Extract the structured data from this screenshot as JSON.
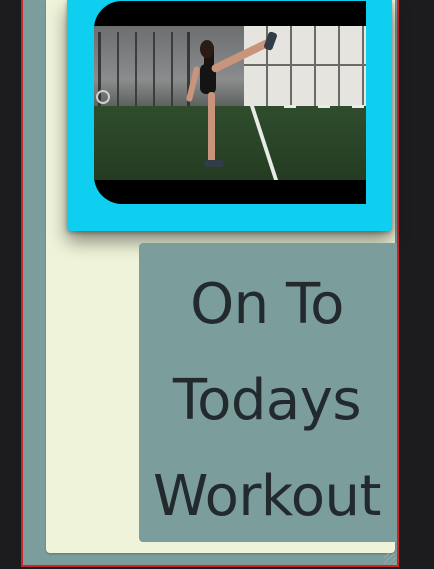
{
  "video": {
    "label": "workout-video",
    "accent_color": "#0ecff0"
  },
  "title_card": {
    "line1": "On To",
    "line2": "Todays",
    "line3": "Workout"
  },
  "colors": {
    "panel_cream": "#eef3d9",
    "panel_teal": "#7b9e9c",
    "frame_border": "#c8262a",
    "text_dark": "#232a2e",
    "background": "#1c1c1e"
  }
}
